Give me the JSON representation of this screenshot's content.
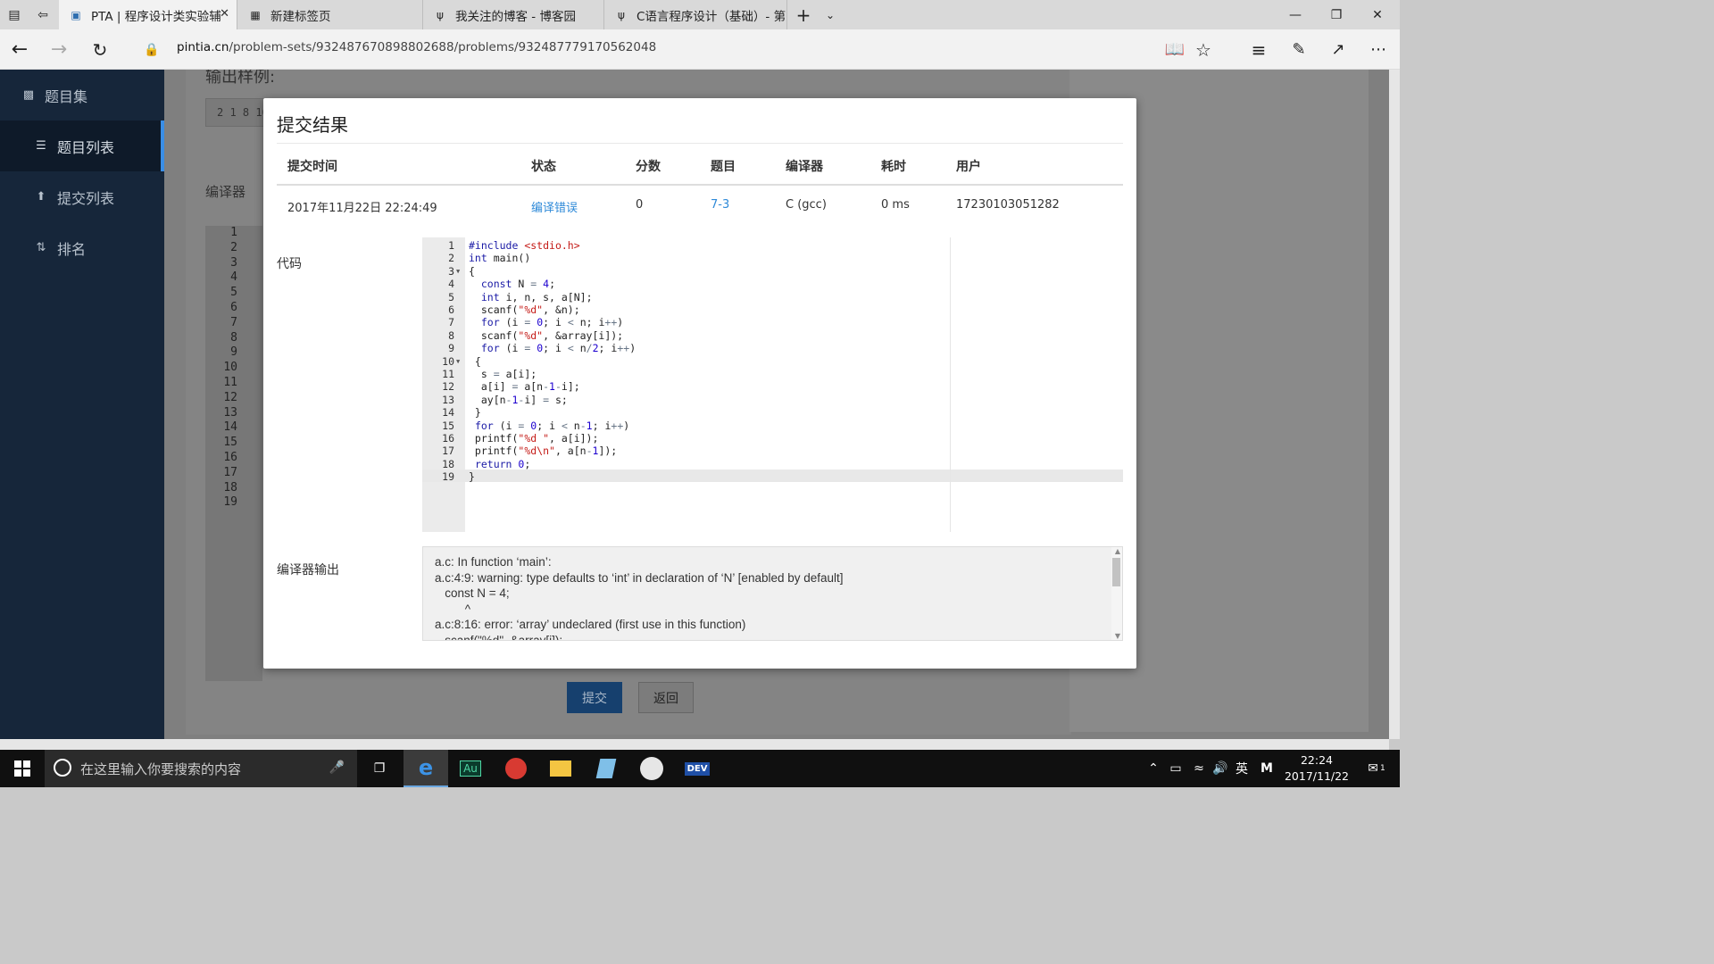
{
  "browser": {
    "tabs": [
      {
        "label": "PTA | 程序设计类实验辅",
        "active": true
      },
      {
        "label": "新建标签页",
        "active": false
      },
      {
        "label": "我关注的博客 - 博客园",
        "active": false
      },
      {
        "label": "C语言程序设计（基础）- 第",
        "active": false
      }
    ],
    "url_host": "pintia.cn",
    "url_path": "/problem-sets/932487670898802688/problems/932487779170562048"
  },
  "sidebar": {
    "items": [
      {
        "label": "题目集",
        "icon": "book-icon"
      },
      {
        "label": "题目列表",
        "icon": "list-icon",
        "active": true
      },
      {
        "label": "提交列表",
        "icon": "upload-icon"
      },
      {
        "label": "排名",
        "icon": "sort-icon"
      }
    ]
  },
  "background": {
    "heading": "输出样例:",
    "sample": "2 1 8 10",
    "compiler_label": "编译器",
    "submit_label": "提交",
    "back_label": "返回",
    "gutter": [
      "1",
      "2",
      "3",
      "4",
      "5",
      "6",
      "7",
      "8",
      "9",
      "10",
      "11",
      "12",
      "13",
      "14",
      "15",
      "16",
      "17",
      "18",
      "19"
    ]
  },
  "modal": {
    "title": "提交结果",
    "columns": [
      "提交时间",
      "状态",
      "分数",
      "题目",
      "编译器",
      "耗时",
      "用户"
    ],
    "row": {
      "time": "2017年11月22日 22:24:49",
      "status": "编译错误",
      "score": "0",
      "problem": "7-3",
      "compiler": "C (gcc)",
      "elapsed": "0 ms",
      "user": "17230103051282"
    },
    "code_label": "代码",
    "output_label": "编译器输出",
    "code_lines": [
      "#include <stdio.h>",
      "int main()",
      "{",
      "  const N = 4;",
      "  int i, n, s, a[N];",
      "  scanf(\"%d\", &n);",
      "  for (i = 0; i < n; i++)",
      "  scanf(\"%d\", &array[i]);",
      "  for (i = 0; i < n/2; i++)",
      " {",
      "  s = a[i];",
      "  a[i] = a[n-1-i];",
      "  ay[n-1-i] = s;",
      " }",
      " for (i = 0; i < n-1; i++)",
      " printf(\"%d \", a[i]);",
      " printf(\"%d\\n\", a[n-1]);",
      " return 0;",
      "}"
    ],
    "compiler_output": "a.c: In function ‘main’:\na.c:4:9: warning: type defaults to ‘int’ in declaration of ‘N’ [enabled by default]\n   const N = 4;\n         ^\na.c:8:16: error: ‘array’ undeclared (first use in this function)\n   scanf(\"%d\", &array[i]);"
  },
  "taskbar": {
    "search_placeholder": "在这里输入你要搜索的内容",
    "ime": "英",
    "time": "22:24",
    "date": "2017/11/22",
    "notifications": "1"
  }
}
